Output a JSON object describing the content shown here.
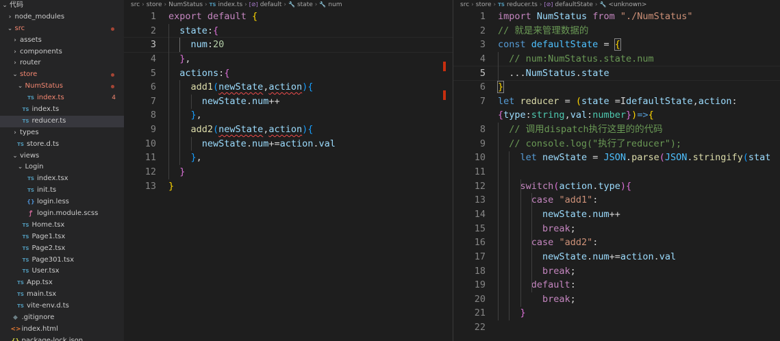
{
  "sidebar": {
    "items": [
      {
        "label": "代码",
        "chev": "⌄",
        "icon": "",
        "depth": 0,
        "state": ""
      },
      {
        "label": "node_modules",
        "chev": "›",
        "icon": "",
        "depth": 1,
        "state": ""
      },
      {
        "label": "src",
        "chev": "⌄",
        "icon": "",
        "depth": 1,
        "state": "err",
        "dot": true
      },
      {
        "label": "assets",
        "chev": "›",
        "icon": "",
        "depth": 2,
        "state": ""
      },
      {
        "label": "components",
        "chev": "›",
        "icon": "",
        "depth": 2,
        "state": ""
      },
      {
        "label": "router",
        "chev": "›",
        "icon": "",
        "depth": 2,
        "state": ""
      },
      {
        "label": "store",
        "chev": "⌄",
        "icon": "",
        "depth": 2,
        "state": "err",
        "dot": true
      },
      {
        "label": "NumStatus",
        "chev": "⌄",
        "icon": "",
        "depth": 3,
        "state": "err",
        "dot": true
      },
      {
        "label": "index.ts",
        "chev": "",
        "icon": "TS",
        "depth": 4,
        "state": "err",
        "count": "4"
      },
      {
        "label": "index.ts",
        "chev": "",
        "icon": "TS",
        "depth": 3,
        "state": ""
      },
      {
        "label": "reducer.ts",
        "chev": "",
        "icon": "TS",
        "depth": 3,
        "state": "",
        "selected": true
      },
      {
        "label": "types",
        "chev": "›",
        "icon": "",
        "depth": 2,
        "state": ""
      },
      {
        "label": "store.d.ts",
        "chev": "",
        "icon": "TS",
        "depth": 2,
        "state": ""
      },
      {
        "label": "views",
        "chev": "⌄",
        "icon": "",
        "depth": 2,
        "state": ""
      },
      {
        "label": "Login",
        "chev": "⌄",
        "icon": "",
        "depth": 3,
        "state": ""
      },
      {
        "label": "index.tsx",
        "chev": "",
        "icon": "TS",
        "depth": 4,
        "state": ""
      },
      {
        "label": "init.ts",
        "chev": "",
        "icon": "TS",
        "depth": 4,
        "state": ""
      },
      {
        "label": "login.less",
        "chev": "",
        "icon": "{}",
        "depth": 4,
        "state": ""
      },
      {
        "label": "login.module.scss",
        "chev": "",
        "icon": "ꝭ",
        "depth": 4,
        "state": ""
      },
      {
        "label": "Home.tsx",
        "chev": "",
        "icon": "TS",
        "depth": 3,
        "state": ""
      },
      {
        "label": "Page1.tsx",
        "chev": "",
        "icon": "TS",
        "depth": 3,
        "state": ""
      },
      {
        "label": "Page2.tsx",
        "chev": "",
        "icon": "TS",
        "depth": 3,
        "state": ""
      },
      {
        "label": "Page301.tsx",
        "chev": "",
        "icon": "TS",
        "depth": 3,
        "state": ""
      },
      {
        "label": "User.tsx",
        "chev": "",
        "icon": "TS",
        "depth": 3,
        "state": ""
      },
      {
        "label": "App.tsx",
        "chev": "",
        "icon": "TS",
        "depth": 2,
        "state": ""
      },
      {
        "label": "main.tsx",
        "chev": "",
        "icon": "TS",
        "depth": 2,
        "state": ""
      },
      {
        "label": "vite-env.d.ts",
        "chev": "",
        "icon": "TS",
        "depth": 2,
        "state": ""
      },
      {
        "label": ".gitignore",
        "chev": "",
        "icon": "◆",
        "depth": 1,
        "state": ""
      },
      {
        "label": "index.html",
        "chev": "",
        "icon": "<>",
        "depth": 1,
        "state": ""
      },
      {
        "label": "package-lock.json",
        "chev": "",
        "icon": "{}",
        "depth": 1,
        "state": ""
      }
    ]
  },
  "left_editor": {
    "breadcrumb": [
      {
        "text": "src",
        "kind": "plain"
      },
      {
        "text": "store",
        "kind": "plain"
      },
      {
        "text": "NumStatus",
        "kind": "plain"
      },
      {
        "text": "TS",
        "kind": "ts"
      },
      {
        "text": "index.ts",
        "kind": "plain"
      },
      {
        "text": "[⊘]",
        "kind": "sym"
      },
      {
        "text": "default",
        "kind": "plain"
      },
      {
        "text": "🔧",
        "kind": "sym"
      },
      {
        "text": "state",
        "kind": "plain"
      },
      {
        "text": "🔧",
        "kind": "sym"
      },
      {
        "text": "num",
        "kind": "plain"
      }
    ],
    "active_line": 3,
    "lines": [
      [
        [
          "kw",
          "export"
        ],
        [
          "p",
          " "
        ],
        [
          "kw",
          "default"
        ],
        [
          "p",
          " "
        ],
        [
          "b1",
          "{"
        ]
      ],
      [
        [
          "p",
          "  "
        ],
        [
          "v",
          "state"
        ],
        [
          "p",
          ":"
        ],
        [
          "b2",
          "{"
        ]
      ],
      [
        [
          "p",
          "    "
        ],
        [
          "v",
          "num"
        ],
        [
          "p",
          ":"
        ],
        [
          "num",
          "20"
        ]
      ],
      [
        [
          "p",
          "  "
        ],
        [
          "b2",
          "}"
        ],
        [
          "p",
          ","
        ]
      ],
      [
        [
          "p",
          "  "
        ],
        [
          "v",
          "actions"
        ],
        [
          "p",
          ":"
        ],
        [
          "b2",
          "{"
        ]
      ],
      [
        [
          "p",
          "    "
        ],
        [
          "f",
          "add1"
        ],
        [
          "b3",
          "("
        ],
        [
          "v squig",
          "newState"
        ],
        [
          "p",
          ","
        ],
        [
          "v squig",
          "action"
        ],
        [
          "b3",
          ")"
        ],
        [
          "b3",
          "{"
        ]
      ],
      [
        [
          "p",
          "      "
        ],
        [
          "v",
          "newState"
        ],
        [
          "p",
          "."
        ],
        [
          "v",
          "num"
        ],
        [
          "p",
          "++"
        ]
      ],
      [
        [
          "p",
          "    "
        ],
        [
          "b3",
          "}"
        ],
        [
          "p",
          ","
        ]
      ],
      [
        [
          "p",
          "    "
        ],
        [
          "f",
          "add2"
        ],
        [
          "b3",
          "("
        ],
        [
          "v squig",
          "newState"
        ],
        [
          "p",
          ","
        ],
        [
          "v squig",
          "action"
        ],
        [
          "b3",
          ")"
        ],
        [
          "b3",
          "{"
        ]
      ],
      [
        [
          "p",
          "      "
        ],
        [
          "v",
          "newState"
        ],
        [
          "p",
          "."
        ],
        [
          "v",
          "num"
        ],
        [
          "p",
          "+="
        ],
        [
          "v",
          "action"
        ],
        [
          "p",
          "."
        ],
        [
          "v",
          "val"
        ]
      ],
      [
        [
          "p",
          "    "
        ],
        [
          "b3",
          "}"
        ],
        [
          "p",
          ","
        ]
      ],
      [
        [
          "p",
          "  "
        ],
        [
          "b2",
          "}"
        ]
      ],
      [
        [
          "b1",
          "}"
        ]
      ]
    ]
  },
  "right_editor": {
    "breadcrumb": [
      {
        "text": "src",
        "kind": "plain"
      },
      {
        "text": "store",
        "kind": "plain"
      },
      {
        "text": "TS",
        "kind": "ts"
      },
      {
        "text": "reducer.ts",
        "kind": "plain"
      },
      {
        "text": "[⊘]",
        "kind": "sym"
      },
      {
        "text": "defaultState",
        "kind": "plain"
      },
      {
        "text": "🔧",
        "kind": "sym"
      },
      {
        "text": "<unknown>",
        "kind": "plain"
      }
    ],
    "active_line": 5,
    "lines": [
      {
        "n": "1",
        "seg": [
          [
            "kw",
            "import"
          ],
          [
            "p",
            " "
          ],
          [
            "v",
            "NumStatus"
          ],
          [
            "p",
            " "
          ],
          [
            "kw",
            "from"
          ],
          [
            "p",
            " "
          ],
          [
            "s",
            "\"./NumStatus\""
          ]
        ]
      },
      {
        "n": "2",
        "seg": [
          [
            "c",
            "// 就是来管理数据的"
          ]
        ]
      },
      {
        "n": "3",
        "seg": [
          [
            "kb",
            "const"
          ],
          [
            "p",
            " "
          ],
          [
            "cn",
            "defaultState"
          ],
          [
            "p",
            " = "
          ],
          [
            "b1 brk-hl",
            "{"
          ]
        ]
      },
      {
        "n": "4",
        "seg": [
          [
            "p",
            "  "
          ],
          [
            "c",
            "// num:NumStatus.state.num"
          ]
        ]
      },
      {
        "n": "5",
        "seg": [
          [
            "p",
            "  ..."
          ],
          [
            "v",
            "NumStatus"
          ],
          [
            "p",
            "."
          ],
          [
            "v",
            "state"
          ]
        ]
      },
      {
        "n": "6",
        "seg": [
          [
            "b1 brk-hl",
            "}"
          ]
        ]
      },
      {
        "n": "7",
        "seg": [
          [
            "kb",
            "let"
          ],
          [
            "p",
            " "
          ],
          [
            "f",
            "reducer"
          ],
          [
            "p",
            " = "
          ],
          [
            "b1",
            "("
          ],
          [
            "v",
            "state"
          ],
          [
            "p",
            " ="
          ],
          [
            "p",
            "I"
          ],
          [
            "v",
            "defaultState"
          ],
          [
            "p",
            ","
          ],
          [
            "v",
            "action"
          ],
          [
            "p",
            ":"
          ]
        ]
      },
      {
        "n": "",
        "seg": [
          [
            "b2",
            "{"
          ],
          [
            "v",
            "type"
          ],
          [
            "p",
            ":"
          ],
          [
            "t",
            "string"
          ],
          [
            "p",
            ","
          ],
          [
            "v",
            "val"
          ],
          [
            "p",
            ":"
          ],
          [
            "t",
            "number"
          ],
          [
            "b2",
            "}"
          ],
          [
            "b1",
            ")"
          ],
          [
            "kb",
            "=>"
          ],
          [
            "b1",
            "{"
          ]
        ]
      },
      {
        "n": "8",
        "seg": [
          [
            "p",
            "  "
          ],
          [
            "c",
            "// 调用dispatch执行这里的的代码"
          ]
        ]
      },
      {
        "n": "9",
        "seg": [
          [
            "p",
            "  "
          ],
          [
            "c",
            "// console.log(\"执行了reducer\");"
          ]
        ]
      },
      {
        "n": "10",
        "seg": [
          [
            "p",
            "    "
          ],
          [
            "kb",
            "let"
          ],
          [
            "p",
            " "
          ],
          [
            "v",
            "newState"
          ],
          [
            "p",
            " = "
          ],
          [
            "cn",
            "JSON"
          ],
          [
            "p",
            "."
          ],
          [
            "f",
            "parse"
          ],
          [
            "b2",
            "("
          ],
          [
            "cn",
            "JSON"
          ],
          [
            "p",
            "."
          ],
          [
            "f",
            "stringify"
          ],
          [
            "b3",
            "("
          ],
          [
            "v",
            "stat"
          ]
        ]
      },
      {
        "n": "11",
        "seg": []
      },
      {
        "n": "12",
        "seg": [
          [
            "p",
            "    "
          ],
          [
            "kw",
            "switch"
          ],
          [
            "b2",
            "("
          ],
          [
            "v",
            "action"
          ],
          [
            "p",
            "."
          ],
          [
            "v",
            "type"
          ],
          [
            "b2",
            ")"
          ],
          [
            "b2",
            "{"
          ]
        ]
      },
      {
        "n": "13",
        "seg": [
          [
            "p",
            "      "
          ],
          [
            "kw",
            "case"
          ],
          [
            "p",
            " "
          ],
          [
            "s",
            "\"add1\""
          ],
          [
            "p",
            ":"
          ]
        ]
      },
      {
        "n": "14",
        "seg": [
          [
            "p",
            "        "
          ],
          [
            "v",
            "newState"
          ],
          [
            "p",
            "."
          ],
          [
            "v",
            "num"
          ],
          [
            "p",
            "++"
          ]
        ]
      },
      {
        "n": "15",
        "seg": [
          [
            "p",
            "        "
          ],
          [
            "kw",
            "break"
          ],
          [
            "p",
            ";"
          ]
        ]
      },
      {
        "n": "16",
        "seg": [
          [
            "p",
            "      "
          ],
          [
            "kw",
            "case"
          ],
          [
            "p",
            " "
          ],
          [
            "s",
            "\"add2\""
          ],
          [
            "p",
            ":"
          ]
        ]
      },
      {
        "n": "17",
        "seg": [
          [
            "p",
            "        "
          ],
          [
            "v",
            "newState"
          ],
          [
            "p",
            "."
          ],
          [
            "v",
            "num"
          ],
          [
            "p",
            "+="
          ],
          [
            "v",
            "action"
          ],
          [
            "p",
            "."
          ],
          [
            "v",
            "val"
          ]
        ]
      },
      {
        "n": "18",
        "seg": [
          [
            "p",
            "        "
          ],
          [
            "kw",
            "break"
          ],
          [
            "p",
            ";"
          ]
        ]
      },
      {
        "n": "19",
        "seg": [
          [
            "p",
            "      "
          ],
          [
            "kw",
            "default"
          ],
          [
            "p",
            ":"
          ]
        ]
      },
      {
        "n": "20",
        "seg": [
          [
            "p",
            "        "
          ],
          [
            "kw",
            "break"
          ],
          [
            "p",
            ";"
          ]
        ]
      },
      {
        "n": "21",
        "seg": [
          [
            "p",
            "    "
          ],
          [
            "b2",
            "}"
          ]
        ]
      },
      {
        "n": "22",
        "seg": []
      }
    ]
  }
}
